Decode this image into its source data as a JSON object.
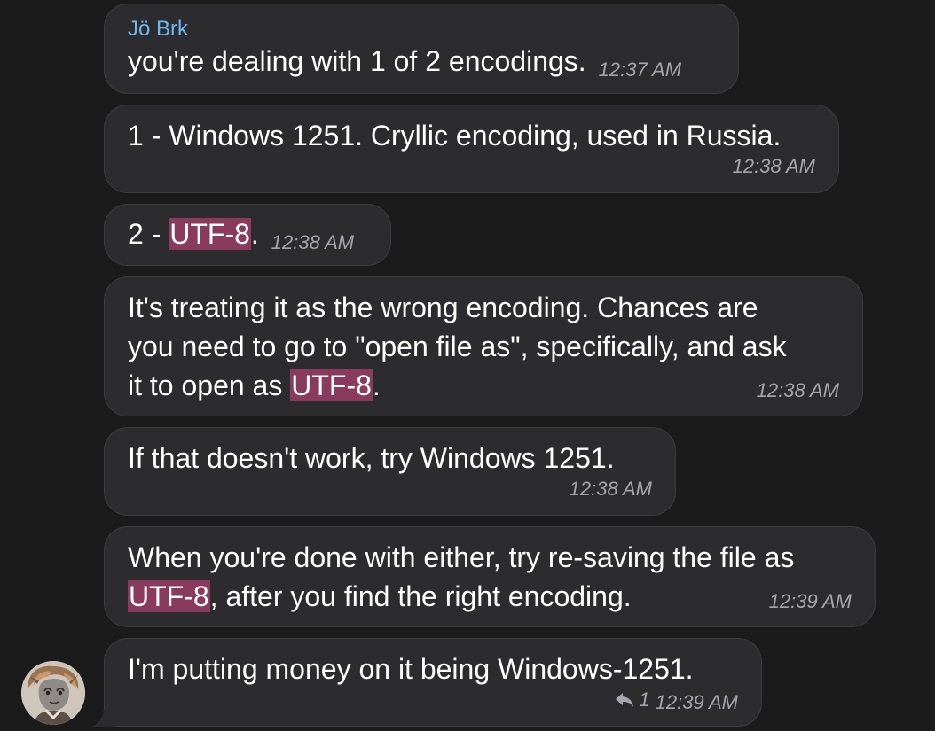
{
  "chat": {
    "messages": [
      {
        "sender": "Jö Brk",
        "text": "you're dealing with 1 of 2 encodings.",
        "time": "12:37 AM"
      },
      {
        "text": "1 - Windows 1251. Cryllic encoding, used in Russia.",
        "time": "12:38 AM"
      },
      {
        "text_before": "2 - ",
        "highlight": "UTF-8",
        "text_after": ".",
        "time": "12:38 AM"
      },
      {
        "line1": "It's treating it as the wrong encoding. Chances are",
        "line2": "you need to go to \"open file as\", specifically, and ask",
        "line3_before": "it to open as ",
        "highlight": "UTF-8",
        "line3_after": ".",
        "time": "12:38 AM"
      },
      {
        "text": "If that doesn't work, try Windows 1251.",
        "time": "12:38 AM"
      },
      {
        "line1": "When you're done with either, try re-saving the file as",
        "highlight": "UTF-8",
        "line2_after": ", after you find the right encoding.",
        "time": "12:39 AM"
      },
      {
        "text": "I'm putting money on it being Windows-1251.",
        "reply_count": "1",
        "time": "12:39 AM"
      }
    ]
  },
  "colors": {
    "background": "#1b1b1c",
    "bubble": "#2c2c2e",
    "sender_name": "#6fb8f0",
    "highlight": "#8a3a5c",
    "timestamp": "#a5a5ad"
  },
  "icons": {
    "reply": "reply-arrow-icon",
    "avatar": "user-avatar"
  }
}
